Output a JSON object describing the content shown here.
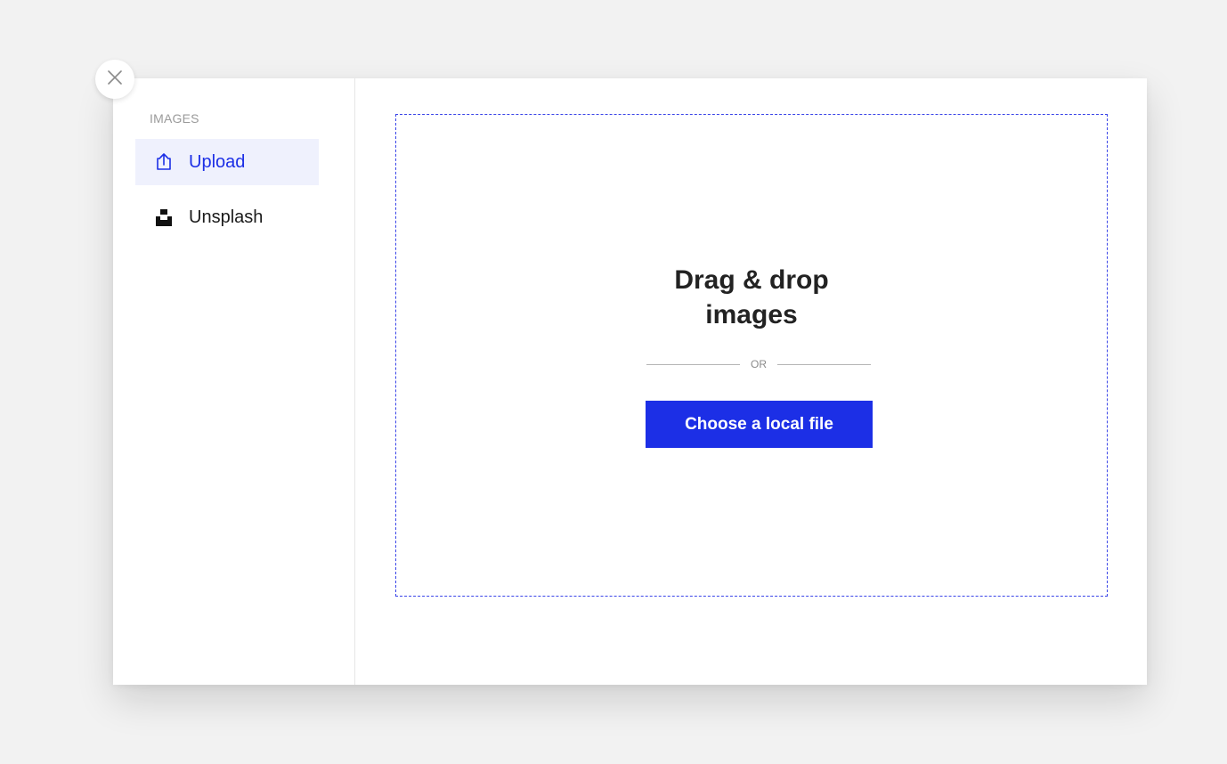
{
  "close": {
    "icon": "close-icon"
  },
  "sidebar": {
    "section_label": "IMAGES",
    "items": [
      {
        "label": "Upload",
        "icon": "upload-icon",
        "active": true
      },
      {
        "label": "Unsplash",
        "icon": "unsplash-icon",
        "active": false
      }
    ]
  },
  "dropzone": {
    "title_line1": "Drag & drop",
    "title_line2": "images",
    "divider_text": "OR",
    "button_label": "Choose a local file"
  },
  "colors": {
    "accent": "#1c2fe6",
    "active_bg": "#eff1fd",
    "dropzone_border": "#3a45e8"
  }
}
